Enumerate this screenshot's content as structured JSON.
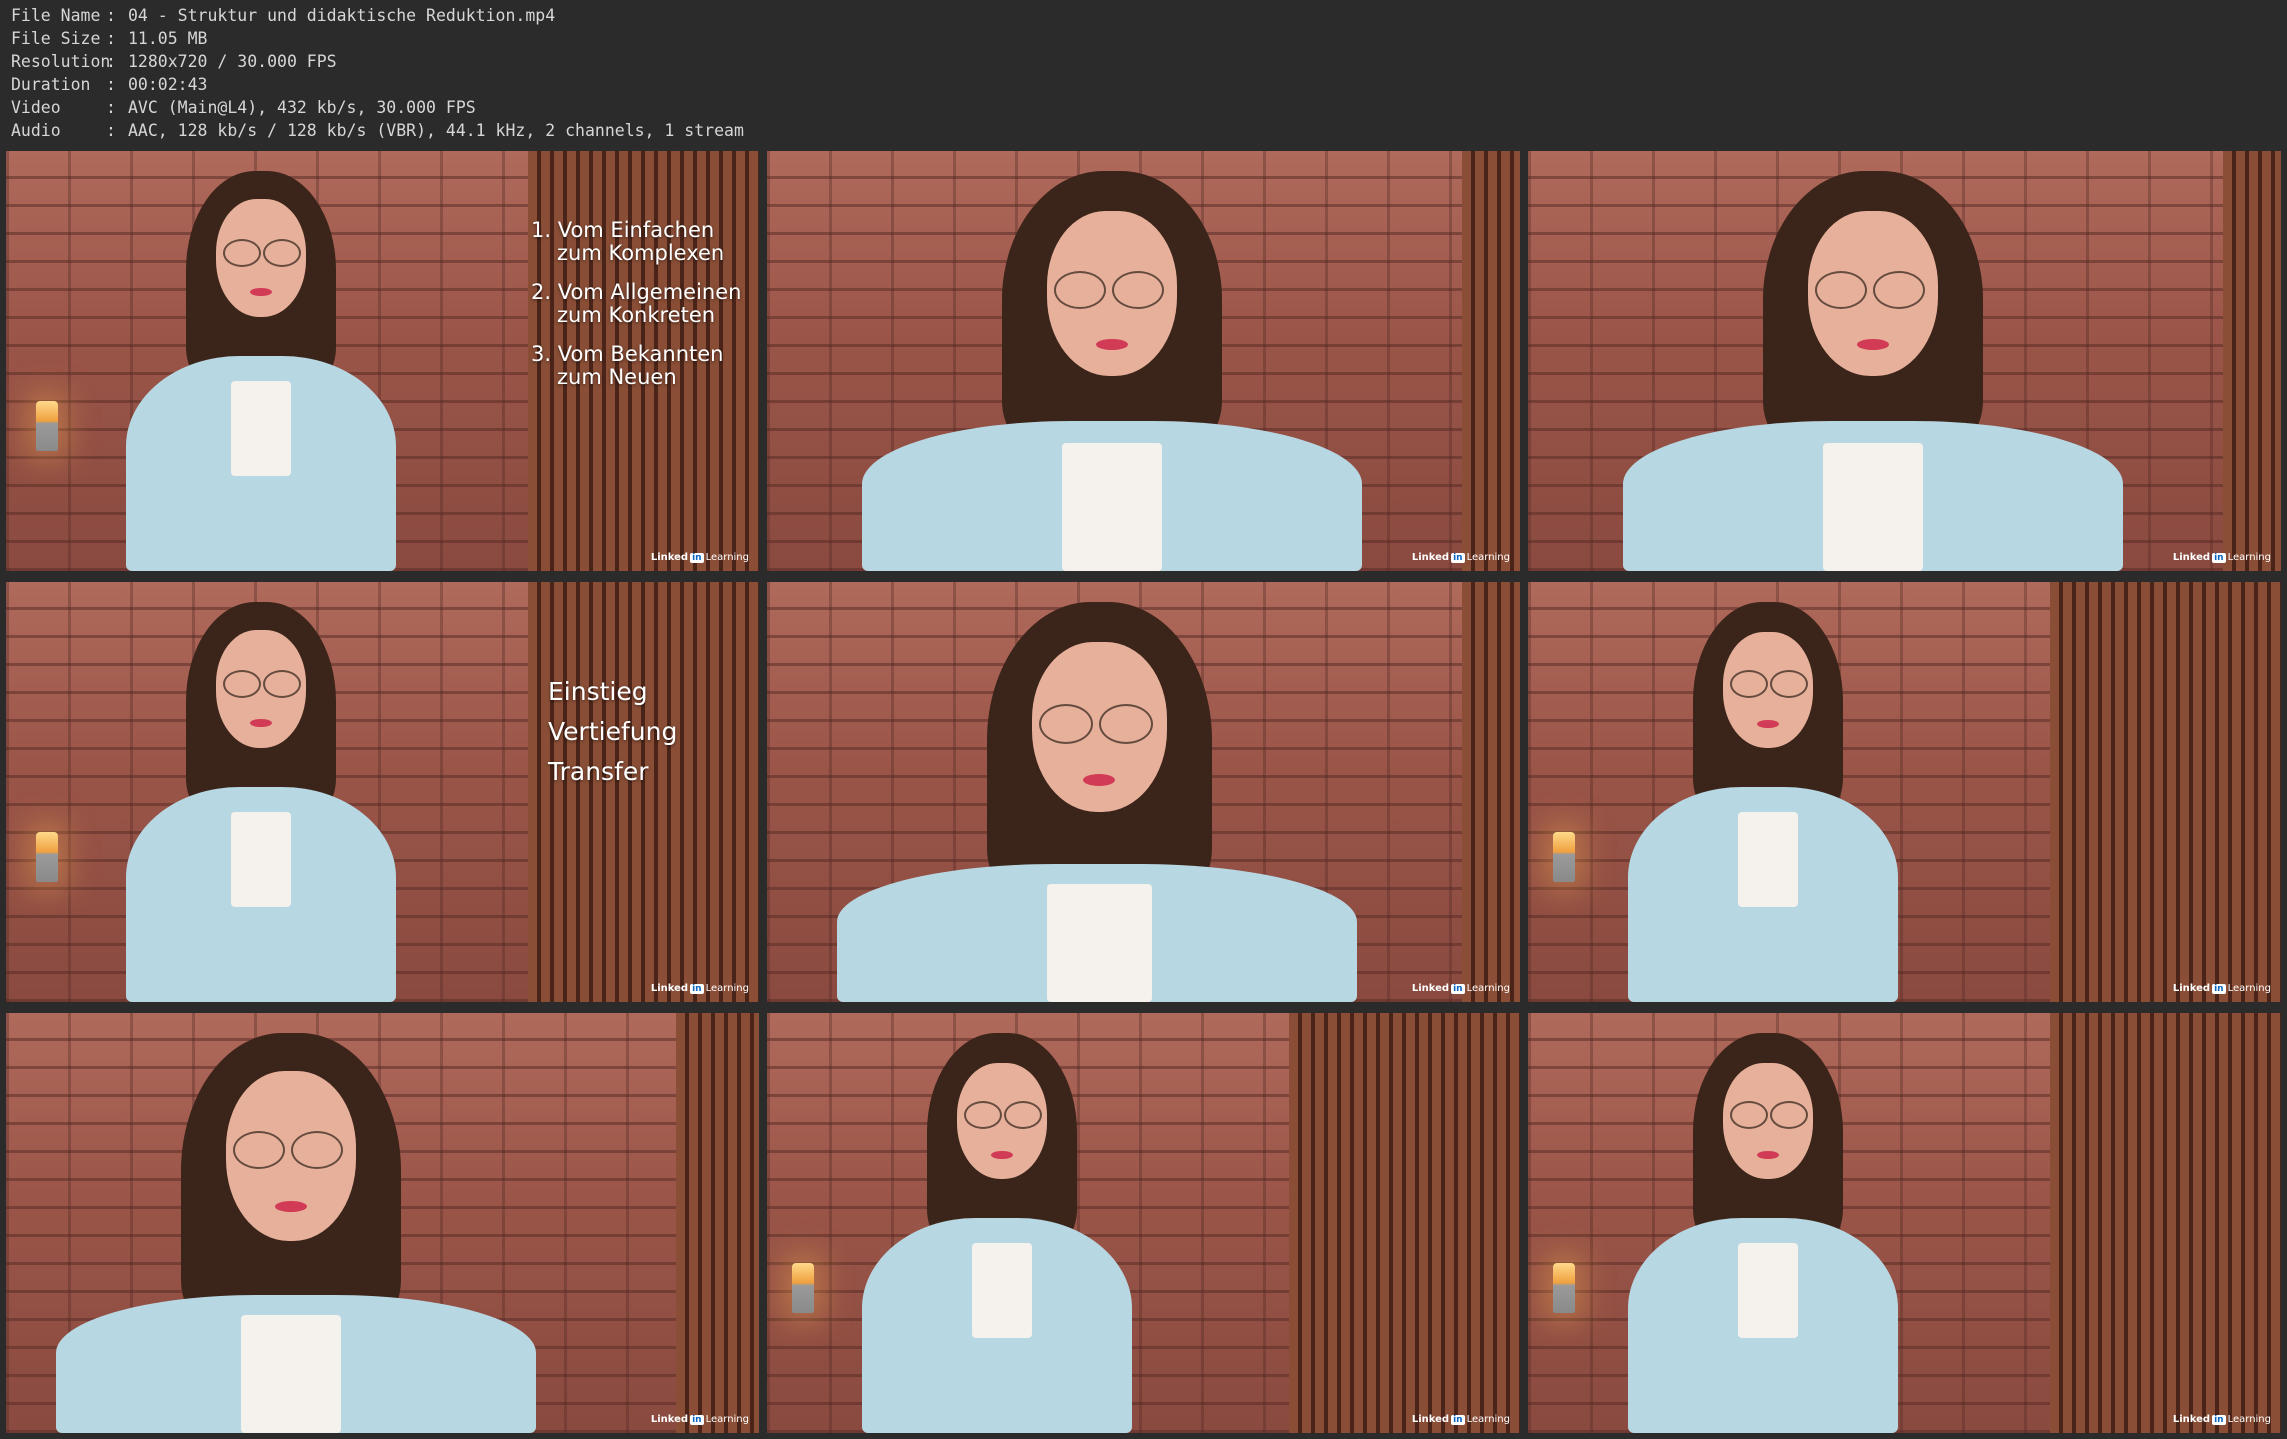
{
  "file_info": [
    {
      "key": "File Name",
      "sep": ":",
      "value": "04 - Struktur und didaktische Reduktion.mp4"
    },
    {
      "key": "File Size",
      "sep": ":",
      "value": "11.05 MB"
    },
    {
      "key": "Resolution",
      "sep": ":",
      "value": "1280x720 / 30.000 FPS"
    },
    {
      "key": "Duration",
      "sep": ":",
      "value": "00:02:43"
    },
    {
      "key": "Video",
      "sep": ":",
      "value": "AVC (Main@L4), 432 kb/s, 30.000 FPS"
    },
    {
      "key": "Audio",
      "sep": ":",
      "value": "AAC, 128 kb/s / 128 kb/s (VBR), 44.1 kHz, 2 channels, 1 stream"
    }
  ],
  "logo": {
    "brand": "Linked",
    "mark": "in",
    "product": "Learning"
  },
  "frames": {
    "f1": {
      "items": [
        {
          "line1": "1. Vom Einfachen",
          "line2": "zum Komplexen"
        },
        {
          "line1": "2. Vom Allgemeinen",
          "line2": "zum Konkreten"
        },
        {
          "line1": "3. Vom Bekannten",
          "line2": "zum Neuen"
        }
      ]
    },
    "f4": {
      "lines": [
        "Einstieg",
        "Vertiefung",
        "Transfer"
      ]
    }
  },
  "colors": {
    "background": "#2b2b2b",
    "blazer": "#b7d7e2",
    "brick": "#9a5548"
  }
}
